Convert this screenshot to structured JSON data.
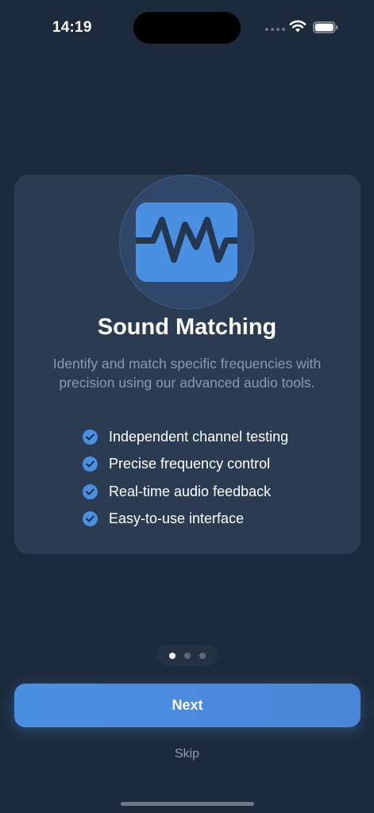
{
  "status_bar": {
    "time": "14:19",
    "icons": [
      "cellular-dots-icon",
      "wifi-icon",
      "battery-icon"
    ]
  },
  "onboarding": {
    "icon": "waveform-icon",
    "title": "Sound Matching",
    "description": "Identify and match specific frequencies with precision using our advanced audio tools.",
    "features": [
      {
        "icon": "checkmark-icon",
        "label": "Independent channel testing"
      },
      {
        "icon": "checkmark-icon",
        "label": "Precise frequency control"
      },
      {
        "icon": "checkmark-icon",
        "label": "Real-time audio feedback"
      },
      {
        "icon": "checkmark-icon",
        "label": "Easy-to-use interface"
      }
    ]
  },
  "pager": {
    "total_pages": 3,
    "current_page": 1
  },
  "actions": {
    "next_label": "Next",
    "skip_label": "Skip"
  },
  "colors": {
    "background": "#1d2a3d",
    "card": "#2b3b52",
    "accent": "#4a90e2",
    "secondary_text": "#8e9aab"
  }
}
